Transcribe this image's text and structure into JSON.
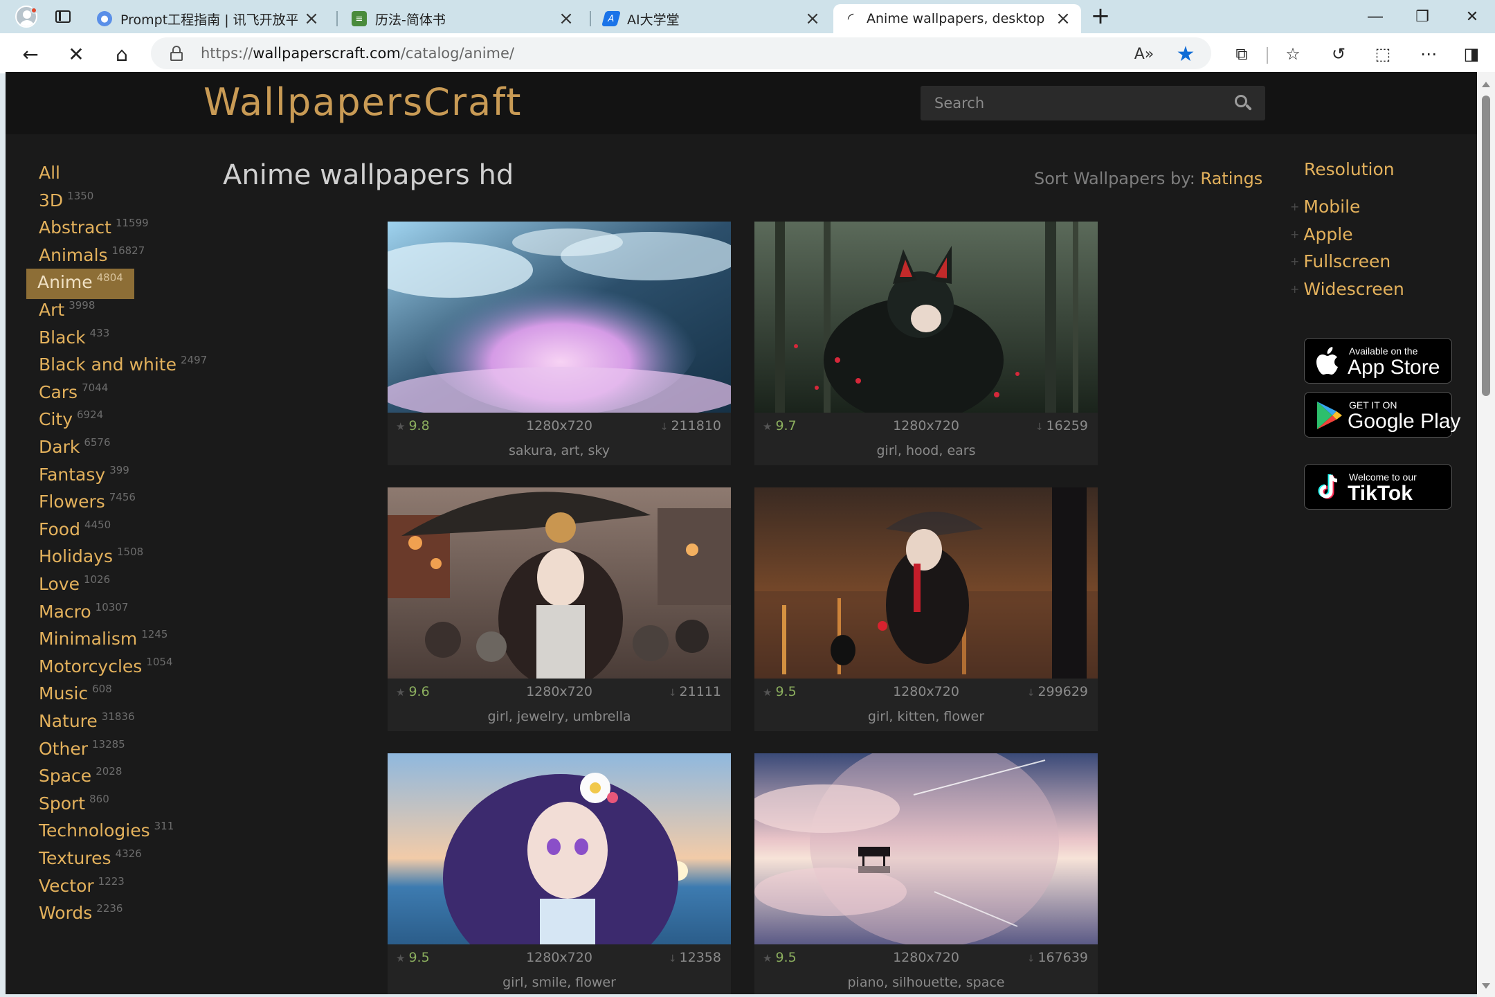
{
  "browser": {
    "tabs": [
      {
        "title": "Prompt工程指南 | 讯飞开放平台",
        "favicon": "chat-bubble-icon",
        "active": false
      },
      {
        "title": "历法-简体书",
        "favicon": "notes-icon",
        "active": false
      },
      {
        "title": "AI大学堂",
        "favicon": "ai-logo-icon",
        "active": false
      },
      {
        "title": "Anime wallpapers, desktop backgr",
        "favicon": "loading-spinner-icon",
        "active": true
      }
    ],
    "url_prefix": "https://",
    "url_host": "wallpaperscraft.com",
    "url_path": "/catalog/anime/"
  },
  "site": {
    "logo": "WallpapersCraft",
    "search_placeholder": "Search",
    "page_title": "Anime wallpapers hd",
    "sort_label": "Sort Wallpapers by: ",
    "sort_value": "Ratings"
  },
  "categories": [
    {
      "name": "All",
      "count": ""
    },
    {
      "name": "3D",
      "count": "1350"
    },
    {
      "name": "Abstract",
      "count": "11599"
    },
    {
      "name": "Animals",
      "count": "16827"
    },
    {
      "name": "Anime",
      "count": "4804",
      "active": true
    },
    {
      "name": "Art",
      "count": "3998"
    },
    {
      "name": "Black",
      "count": "433"
    },
    {
      "name": "Black and white",
      "count": "2497"
    },
    {
      "name": "Cars",
      "count": "7044"
    },
    {
      "name": "City",
      "count": "6924"
    },
    {
      "name": "Dark",
      "count": "6576"
    },
    {
      "name": "Fantasy",
      "count": "399"
    },
    {
      "name": "Flowers",
      "count": "7456"
    },
    {
      "name": "Food",
      "count": "4450"
    },
    {
      "name": "Holidays",
      "count": "1508"
    },
    {
      "name": "Love",
      "count": "1026"
    },
    {
      "name": "Macro",
      "count": "10307"
    },
    {
      "name": "Minimalism",
      "count": "1245"
    },
    {
      "name": "Motorcycles",
      "count": "1054"
    },
    {
      "name": "Music",
      "count": "608"
    },
    {
      "name": "Nature",
      "count": "31836"
    },
    {
      "name": "Other",
      "count": "13285"
    },
    {
      "name": "Space",
      "count": "2028"
    },
    {
      "name": "Sport",
      "count": "860"
    },
    {
      "name": "Technologies",
      "count": "311"
    },
    {
      "name": "Textures",
      "count": "4326"
    },
    {
      "name": "Vector",
      "count": "1223"
    },
    {
      "name": "Words",
      "count": "2236"
    }
  ],
  "wallpapers": [
    {
      "rating": "9.8",
      "resolution": "1280x720",
      "downloads": "211810",
      "tags": "sakura, art, sky"
    },
    {
      "rating": "9.7",
      "resolution": "1280x720",
      "downloads": "16259",
      "tags": "girl, hood, ears"
    },
    {
      "rating": "9.6",
      "resolution": "1280x720",
      "downloads": "21111",
      "tags": "girl, jewelry, umbrella"
    },
    {
      "rating": "9.5",
      "resolution": "1280x720",
      "downloads": "299629",
      "tags": "girl, kitten, flower"
    },
    {
      "rating": "9.5",
      "resolution": "1280x720",
      "downloads": "12358",
      "tags": "girl, smile, flower"
    },
    {
      "rating": "9.5",
      "resolution": "1280x720",
      "downloads": "167639",
      "tags": "piano, silhouette, space"
    }
  ],
  "resolution": {
    "heading": "Resolution",
    "items": [
      "Mobile",
      "Apple",
      "Fullscreen",
      "Widescreen"
    ]
  },
  "stores": {
    "appstore_small": "Available on the",
    "appstore_big": "App Store",
    "googleplay_small": "GET IT ON",
    "googleplay_big": "Google Play",
    "tiktok_small": "Welcome to our",
    "tiktok_big": "TikTok"
  },
  "colors": {
    "accent": "#e3b15c",
    "page_bg": "#1a1a1a",
    "active_category_bg": "#8d6e36",
    "rating_green": "#8bae5e"
  }
}
